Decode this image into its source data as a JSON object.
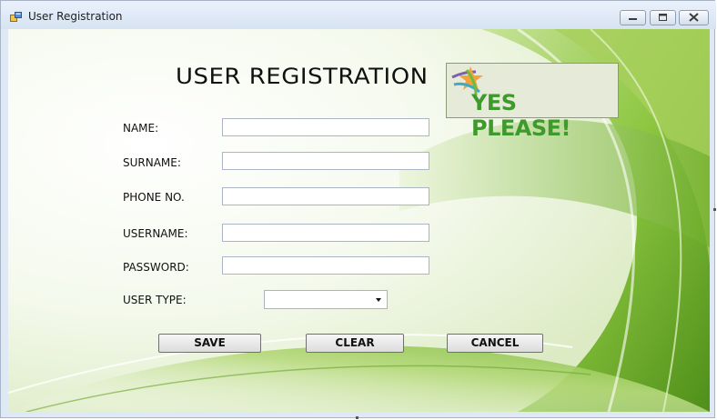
{
  "window": {
    "title": "User Registration",
    "controls": [
      "minimize-icon",
      "maximize-icon",
      "close-icon"
    ]
  },
  "form": {
    "heading": "USER REGISTRATION",
    "logo_text": "YES PLEASE!",
    "fields": {
      "name": {
        "label": "NAME:",
        "value": ""
      },
      "surname": {
        "label": "SURNAME:",
        "value": ""
      },
      "phone": {
        "label": "PHONE NO.",
        "value": ""
      },
      "username": {
        "label": "USERNAME:",
        "value": ""
      },
      "password": {
        "label": "PASSWORD:",
        "value": ""
      },
      "user_type": {
        "label": "USER TYPE:",
        "value": ""
      }
    },
    "buttons": {
      "save": "SAVE",
      "clear": "CLEAR",
      "cancel": "CANCEL"
    }
  },
  "colors": {
    "accent_green": "#7dbb2c",
    "logo_text": "#3f9a2d",
    "title_bar": "#dfe9f5"
  }
}
